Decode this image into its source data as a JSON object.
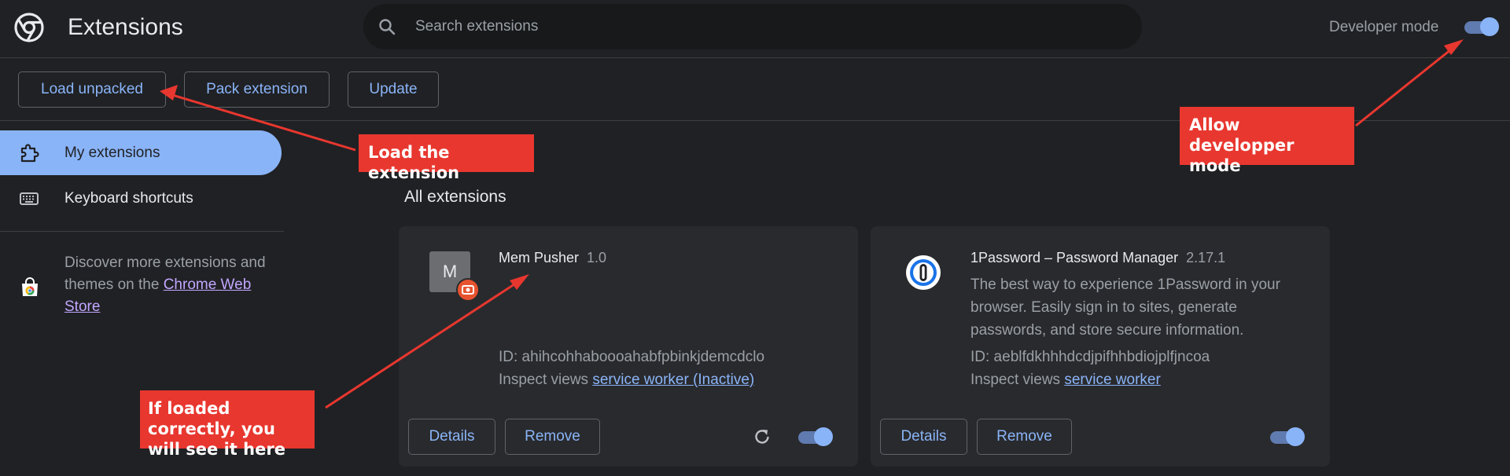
{
  "header": {
    "title": "Extensions",
    "search_placeholder": "Search extensions",
    "developer_mode_label": "Developer mode",
    "developer_mode_on": true
  },
  "toolbar": {
    "load_unpacked": "Load unpacked",
    "pack_extension": "Pack extension",
    "update": "Update"
  },
  "sidebar": {
    "items": [
      {
        "label": "My extensions",
        "icon": "extension-icon",
        "active": true
      },
      {
        "label": "Keyboard shortcuts",
        "icon": "keyboard-icon",
        "active": false
      }
    ],
    "discover_text": "Discover more extensions and themes on the",
    "webstore_link": "Chrome Web Store"
  },
  "main": {
    "section_title": "All extensions",
    "extensions": [
      {
        "name": "Mem Pusher",
        "version": "1.0",
        "icon_letter": "M",
        "description": "",
        "id_text": "ID: ahihcohhaboooahabfpbinkjdemcdclo",
        "inspect_label": "Inspect views",
        "inspect_link": "service worker (Inactive)",
        "details": "Details",
        "remove": "Remove",
        "enabled": true
      },
      {
        "name": "1Password – Password Manager",
        "version": "2.17.1",
        "icon": "1password-icon",
        "description": "The best way to experience 1Password in your browser. Easily sign in to sites, generate passwords, and store secure information.",
        "id_text": "ID: aeblfdkhhhdcdjpifhhbdiojplfjncoa",
        "inspect_label": "Inspect views",
        "inspect_link": "service worker",
        "details": "Details",
        "remove": "Remove",
        "enabled": true
      }
    ]
  },
  "annotations": {
    "load": "Load the extension",
    "devmode": "Allow developper mode",
    "loaded": "If loaded correctly, you will see it here",
    "color": "#e8372f"
  },
  "colors": {
    "background": "#202124",
    "card": "#292a2d",
    "accent": "#8ab4f8",
    "link": "#c2a6ff"
  }
}
